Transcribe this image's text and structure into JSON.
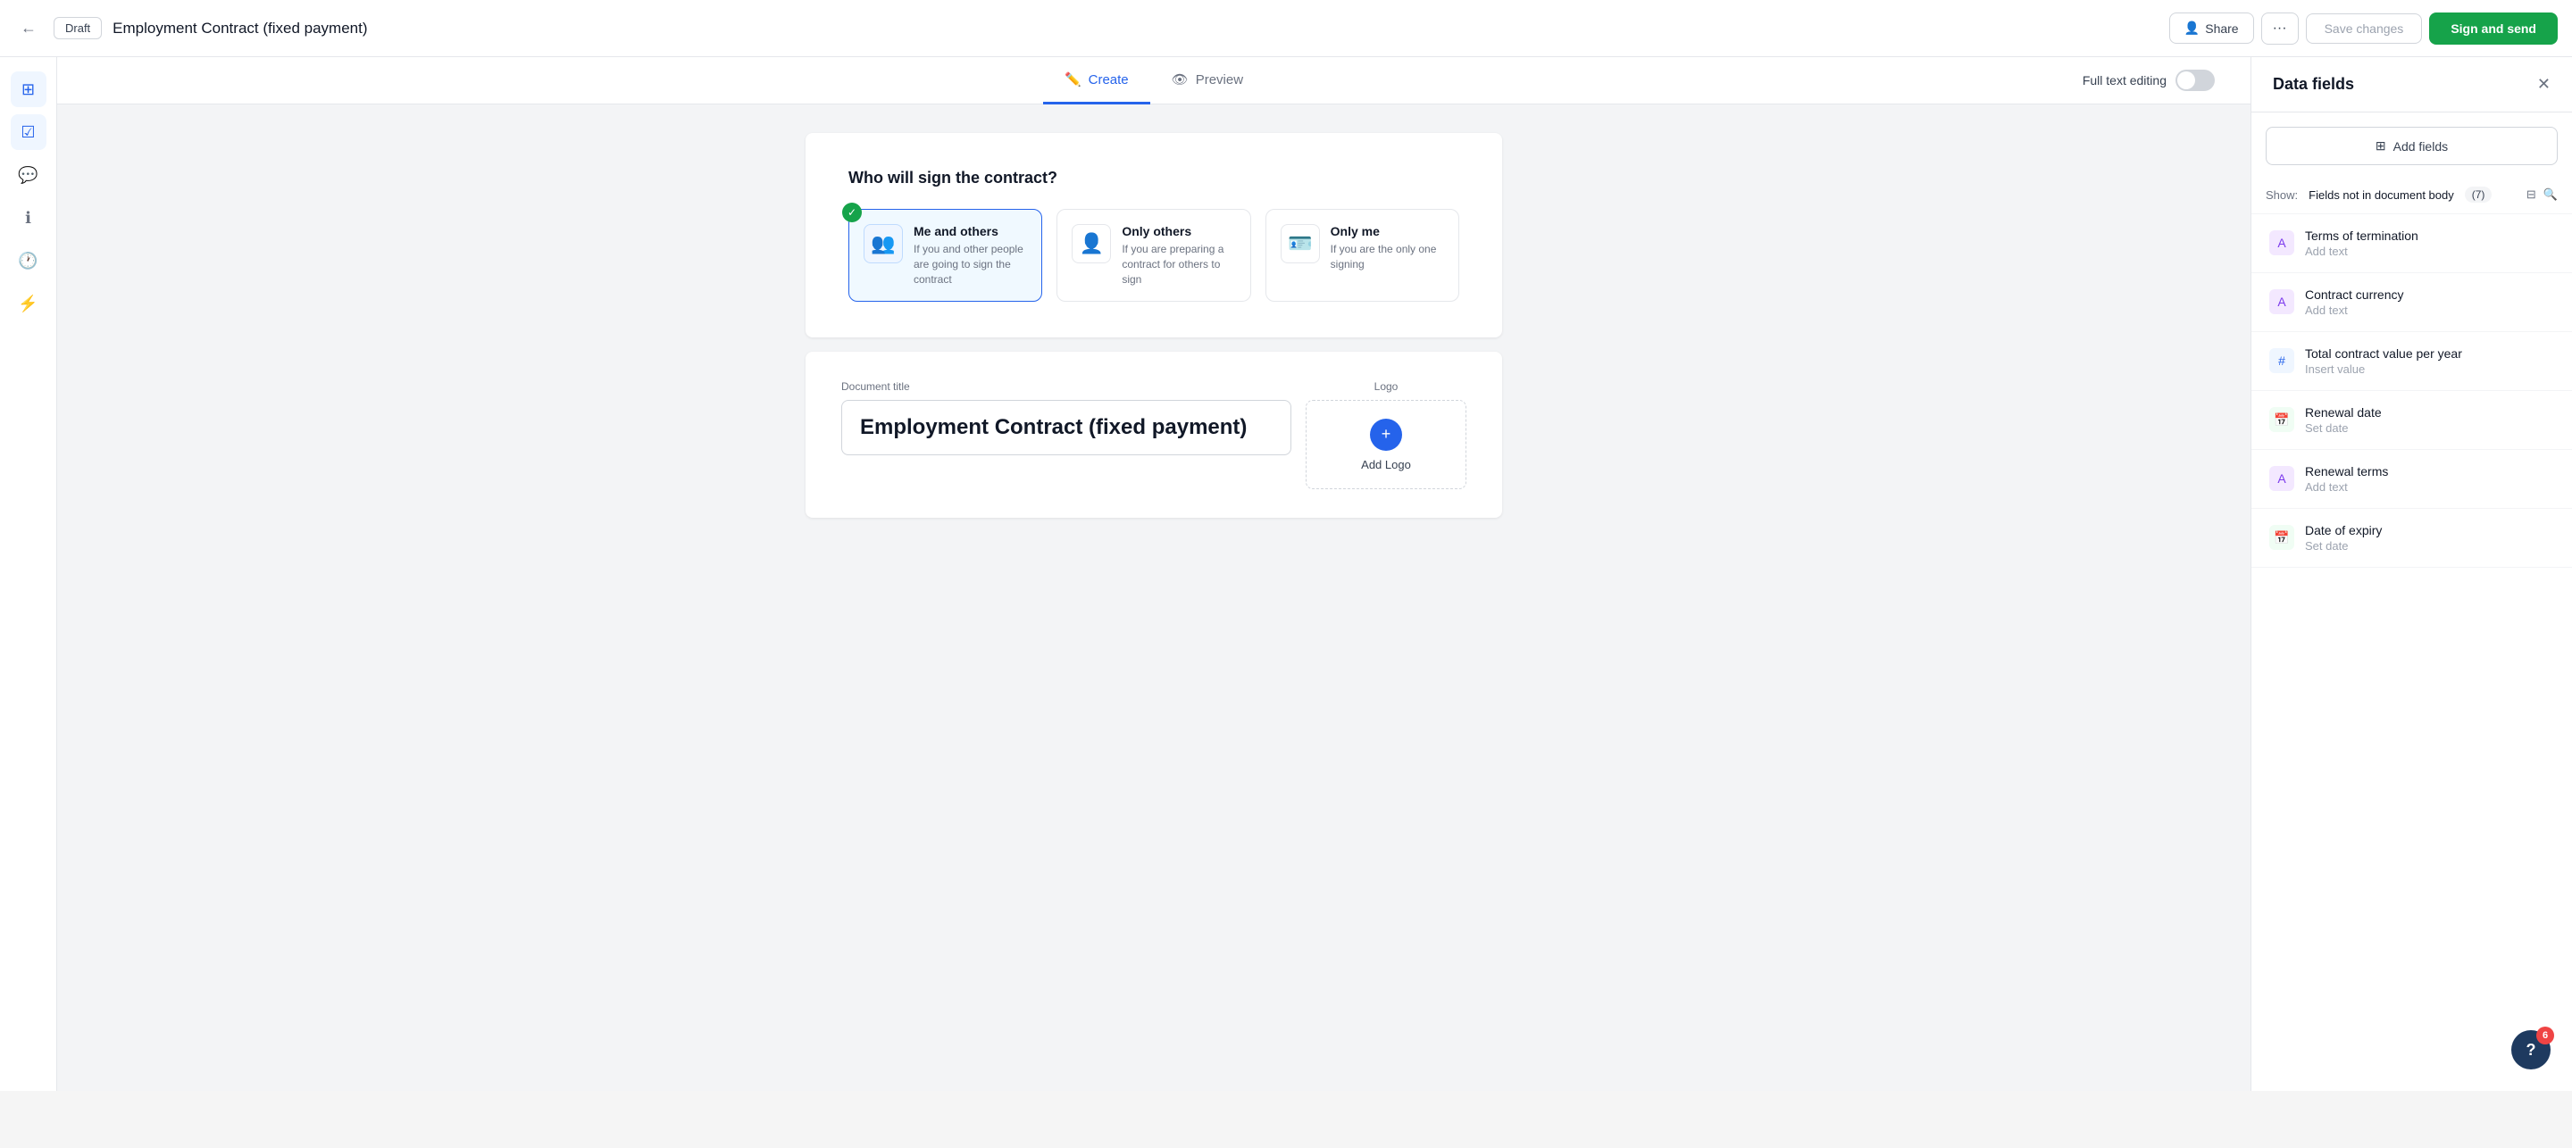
{
  "header": {
    "back_label": "←",
    "draft_label": "Draft",
    "doc_title": "Employment Contract (fixed payment)",
    "share_label": "Share",
    "more_label": "···",
    "save_label": "Save changes",
    "sign_label": "Sign and send"
  },
  "tabs": {
    "create_label": "Create",
    "preview_label": "Preview",
    "full_text_editing_label": "Full text editing"
  },
  "signer_section": {
    "title": "Who will sign the contract?",
    "options": [
      {
        "id": "me-and-others",
        "title": "Me and others",
        "desc": "If you and other people are going to sign the contract",
        "selected": true
      },
      {
        "id": "only-others",
        "title": "Only others",
        "desc": "If you are preparing a contract for others to sign",
        "selected": false
      },
      {
        "id": "only-me",
        "title": "Only me",
        "desc": "If you are the only one signing",
        "selected": false
      }
    ]
  },
  "document_form": {
    "title_label": "Document title",
    "title_value": "Employment Contract (fixed payment)",
    "logo_label": "Logo",
    "logo_upload_text": "Add Logo"
  },
  "right_panel": {
    "title": "Data fields",
    "close_label": "✕",
    "add_fields_label": "Add fields",
    "show_label": "Show:",
    "show_value": "Fields not in document body",
    "count": "(7)",
    "fields": [
      {
        "name": "Terms of termination",
        "action": "Add text",
        "icon_type": "text-icon"
      },
      {
        "name": "Contract currency",
        "action": "Add text",
        "icon_type": "currency-icon"
      },
      {
        "name": "Total contract value per year",
        "action": "Insert value",
        "icon_type": "number-icon"
      },
      {
        "name": "Renewal date",
        "action": "Set date",
        "icon_type": "date-icon"
      },
      {
        "name": "Renewal terms",
        "action": "Add text",
        "icon_type": "text-icon"
      },
      {
        "name": "Date of expiry",
        "action": "Set date",
        "icon_type": "date-icon"
      }
    ]
  },
  "help": {
    "count": "6",
    "label": "?"
  },
  "sidebar_icons": [
    {
      "name": "layout-icon",
      "symbol": "⊞"
    },
    {
      "name": "check-icon",
      "symbol": "☑"
    },
    {
      "name": "comment-icon",
      "symbol": "💬"
    },
    {
      "name": "info-icon",
      "symbol": "ℹ"
    },
    {
      "name": "history-icon",
      "symbol": "🕐"
    },
    {
      "name": "zap-icon",
      "symbol": "⚡"
    }
  ]
}
